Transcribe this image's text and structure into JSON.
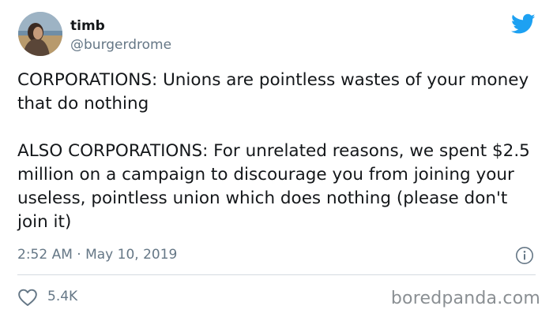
{
  "author": {
    "display_name": "timb",
    "handle": "@burgerdrome"
  },
  "tweet": {
    "paragraphs": [
      "CORPORATIONS: Unions are pointless wastes of your money that do nothing",
      "ALSO CORPORATIONS: For unrelated reasons, we spent $2.5 million on a campaign to discourage you from joining your useless, pointless union which does nothing (please don't join it)"
    ],
    "timestamp": "2:52 AM · May 10, 2019"
  },
  "engagement": {
    "likes": "5.4K"
  },
  "watermark": "boredpanda.com",
  "colors": {
    "twitter_blue": "#1da1f2",
    "secondary_text": "#657786",
    "primary_text": "#14171a",
    "divider": "#d4dbe0"
  },
  "icons": {
    "brand": "twitter-bird-icon",
    "info": "info-icon",
    "like": "heart-icon"
  }
}
